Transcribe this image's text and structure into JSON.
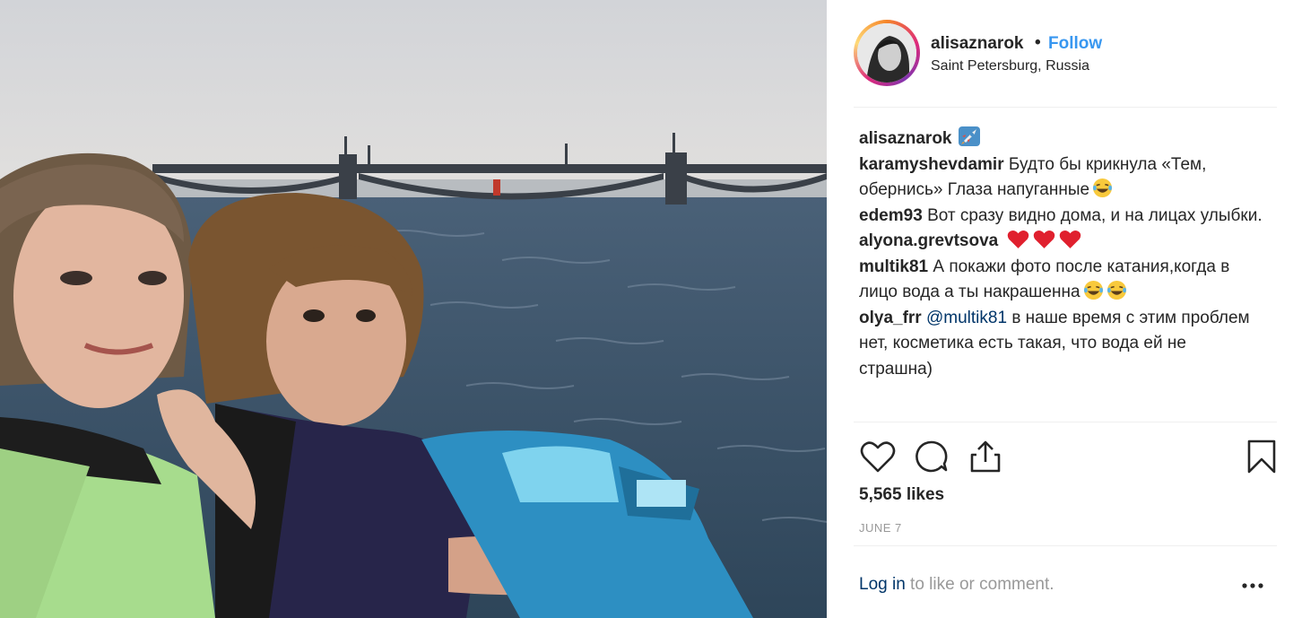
{
  "post": {
    "author": "alisaznarok",
    "separator": "•",
    "follow_label": "Follow",
    "location": "Saint Petersburg, Russia",
    "caption_emoji": "rocket-icon"
  },
  "comments": [
    {
      "user": "karamyshevdamir",
      "text": "Будто бы крикнула «Тем, обернись» Глаза напуганные",
      "emoji_count": 1
    },
    {
      "user": "edem93",
      "text": "Вот сразу видно дома, и на лицах улыбки.",
      "emoji_count": 0
    },
    {
      "user": "alyona.grevtsova",
      "text": "",
      "hearts": 3
    },
    {
      "user": "multik81",
      "text": "А покажи фото после катания,когда в лицо вода а ты накрашенна",
      "emoji_count": 2
    },
    {
      "user": "olya_frr",
      "mention": "@multik81",
      "text": "в наше время с этим проблем нет, косметика есть такая, что вода ей не страшна)"
    }
  ],
  "stats": {
    "likes": "5,565 likes",
    "date": "JUNE 7"
  },
  "footer": {
    "login_link": "Log in",
    "login_rest": " to like or comment."
  },
  "icons": {
    "like": "heart-outline-icon",
    "comment": "comment-bubble-icon",
    "share": "share-icon",
    "save": "bookmark-icon",
    "more": "more-options-icon"
  },
  "colors": {
    "link": "#3897f0",
    "mention": "#003569",
    "muted": "#999999",
    "heart": "#e0202e"
  }
}
